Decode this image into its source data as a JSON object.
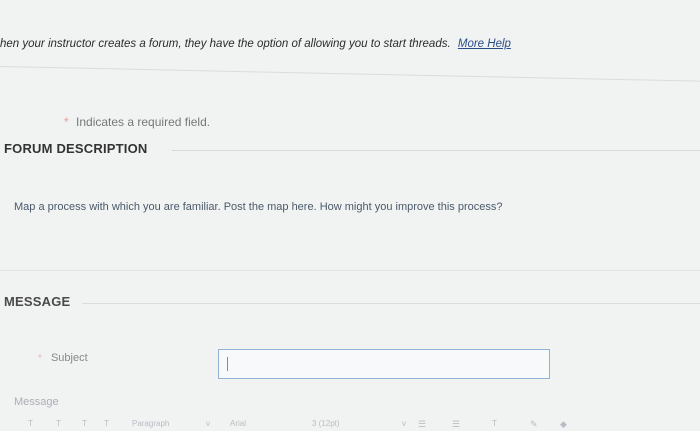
{
  "intro": {
    "text": "hen your instructor creates a forum, they have the option of allowing you to start threads.",
    "more_help": "More Help"
  },
  "required_note": {
    "star": "*",
    "text": "Indicates a required field."
  },
  "forum_description": {
    "title": "FORUM DESCRIPTION",
    "text": "Map a process with which you are familiar. Post the map here. How might you improve this process?"
  },
  "message_section": {
    "title": "MESSAGE",
    "subject_label": "Subject",
    "subject_value": "",
    "message_label": "Message"
  },
  "toolbar": {
    "t1": "T",
    "t2": "T",
    "t3": "T",
    "t4": "T",
    "paragraph": "Paragraph",
    "font": "Arial",
    "size": "3 (12pt)",
    "chevron": "v",
    "t5": "T"
  }
}
